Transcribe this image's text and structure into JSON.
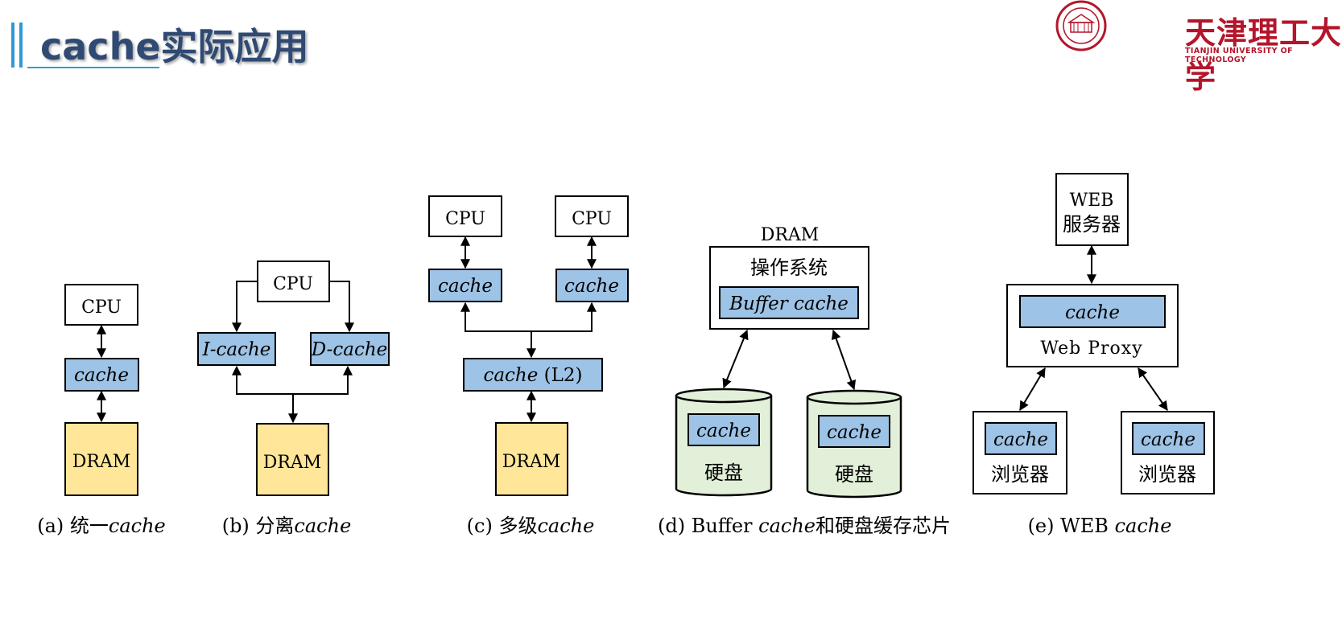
{
  "slide": {
    "title": "cache实际应用",
    "logo_cn": "天津理工大学",
    "logo_en": "TIANJIN UNIVERSITY OF TECHNOLOGY"
  },
  "colors": {
    "title": "#2f4a73",
    "cache_fill": "#9dc3e6",
    "dram_fill": "#ffe699",
    "disk_fill": "#e2f0d9",
    "logo": "#b4152b",
    "accent_bar": "#2e9bd6"
  },
  "diagrams": {
    "a": {
      "cpu": "CPU",
      "cache": "cache",
      "dram": "DRAM",
      "caption_prefix": "(a) 统一",
      "caption_italic": "cache"
    },
    "b": {
      "cpu": "CPU",
      "icache": "I-cache",
      "dcache": "D-cache",
      "dram": "DRAM",
      "caption_prefix": "(b) 分离",
      "caption_italic": "cache"
    },
    "c": {
      "cpu1": "CPU",
      "cpu2": "CPU",
      "cache1": "cache",
      "cache2": "cache",
      "l2_italic": "cache",
      "l2_suffix": " (L2)",
      "dram": "DRAM",
      "caption_prefix": "(c) 多级",
      "caption_italic": "cache"
    },
    "d": {
      "dram": "DRAM",
      "os": "操作系统",
      "buffer_cache": "Buffer cache",
      "disk1_cache": "cache",
      "disk1_label": "硬盘",
      "disk2_cache": "cache",
      "disk2_label": "硬盘",
      "caption_prefix": "(d) Buffer ",
      "caption_italic": "cache",
      "caption_suffix": "和硬盘缓存芯片"
    },
    "e": {
      "server_line1": "WEB",
      "server_line2": "服务器",
      "proxy_cache": "cache",
      "proxy": "Web Proxy",
      "browser1_cache": "cache",
      "browser1": "浏览器",
      "browser2_cache": "cache",
      "browser2": "浏览器",
      "caption_prefix": "(e) WEB ",
      "caption_italic": "cache"
    }
  }
}
